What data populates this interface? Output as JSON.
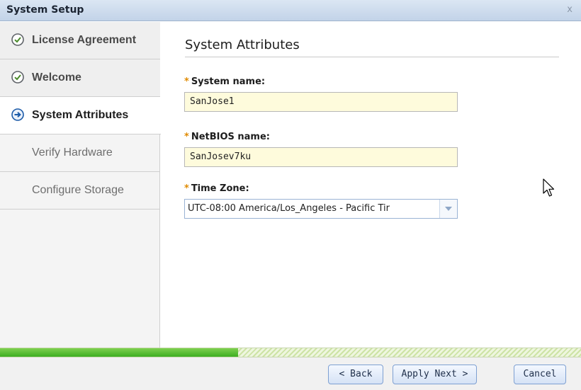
{
  "window": {
    "title": "System Setup",
    "close_glyph": "x"
  },
  "sidebar": {
    "steps": [
      {
        "label": "License Agreement",
        "state": "done",
        "icon": "check-circle-icon"
      },
      {
        "label": "Welcome",
        "state": "done",
        "icon": "check-circle-icon"
      },
      {
        "label": "System Attributes",
        "state": "current",
        "icon": "arrow-circle-icon"
      },
      {
        "label": "Verify Hardware",
        "state": "pending"
      },
      {
        "label": "Configure Storage",
        "state": "pending"
      }
    ]
  },
  "main": {
    "heading": "System Attributes",
    "required_marker": "*",
    "fields": {
      "system_name": {
        "label": "System name:",
        "value": "SanJose1"
      },
      "netbios_name": {
        "label": "NetBIOS name:",
        "value": "SanJosev7ku"
      },
      "time_zone": {
        "label": "Time Zone:",
        "value": "UTC-08:00 America/Los_Angeles  -  Pacific Tir"
      }
    }
  },
  "progress": {
    "fraction": 0.41
  },
  "footer": {
    "back_label": "< Back",
    "apply_next_label": "Apply Next >",
    "cancel_label": "Cancel"
  },
  "colors": {
    "required_star": "#e08a00",
    "input_highlight": "#fefbdc",
    "progress_green": "#3cae21",
    "check_icon": "#5f6368",
    "arrow_icon": "#1b5aa8"
  }
}
